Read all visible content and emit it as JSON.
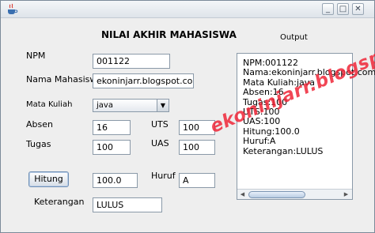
{
  "window": {
    "title": ""
  },
  "form": {
    "heading": "NILAI AKHIR MAHASISWA",
    "npm_label": "NPM",
    "npm_value": "001122",
    "nama_label": "Nama Mahasiswa",
    "nama_value": "ekoninjarr.blogspot.com",
    "matkul_label": "Mata Kuliah",
    "matkul_selected": "java",
    "absen_label": "Absen",
    "absen_value": "16",
    "uts_label": "UTS",
    "uts_value": "100",
    "tugas_label": "Tugas",
    "tugas_value": "100",
    "uas_label": "UAS",
    "uas_value": "100",
    "hitung_button": "Hitung",
    "hitung_value": "100.0",
    "huruf_label": "Huruf",
    "huruf_value": "A",
    "keterangan_label": "Keterangan",
    "keterangan_value": "LULUS"
  },
  "output": {
    "label": "Output",
    "lines": [
      "NPM:001122",
      "Nama:ekoninjarr.blogspot.com",
      "Mata Kuliah:java",
      "Absen:16",
      "Tugas:100",
      "UTS:100",
      "UAS:100",
      "Hitung:100.0",
      "Huruf:A",
      "Keterangan:LULUS"
    ]
  },
  "watermark": "ekoninjarr.blogspot.com",
  "colors": {
    "watermark": "#ee2637",
    "desktop": "#6e7f92"
  }
}
